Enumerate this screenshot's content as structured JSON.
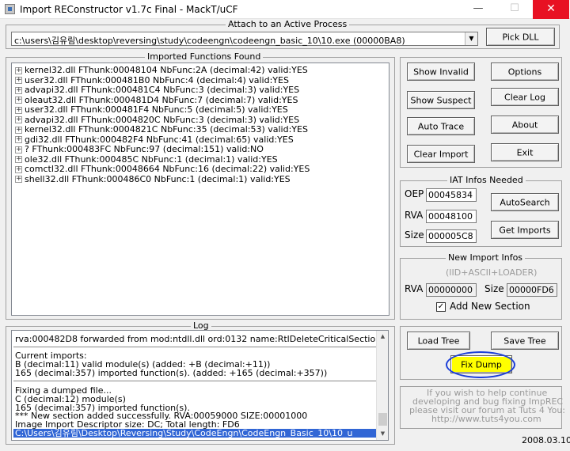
{
  "window": {
    "title": "Import REConstructor v1.7c Final - MackT/uCF",
    "controls": {
      "minimize": "—",
      "maximize": "☐",
      "close": "✕"
    }
  },
  "attach": {
    "group_title": "Attach to an Active Process",
    "process": "c:\\users\\김유림\\desktop\\reversing\\study\\codeengn\\codeengn_basic_10\\10.exe (00000BA8)",
    "pick_dll": "Pick DLL"
  },
  "imports": {
    "group_title": "Imported Functions Found",
    "rows": [
      "kernel32.dll FThunk:00048104 NbFunc:2A (decimal:42) valid:YES",
      "user32.dll FThunk:000481B0 NbFunc:4 (decimal:4) valid:YES",
      "advapi32.dll FThunk:000481C4 NbFunc:3 (decimal:3) valid:YES",
      "oleaut32.dll FThunk:000481D4 NbFunc:7 (decimal:7) valid:YES",
      "user32.dll FThunk:000481F4 NbFunc:5 (decimal:5) valid:YES",
      "advapi32.dll FThunk:0004820C NbFunc:3 (decimal:3) valid:YES",
      "kernel32.dll FThunk:0004821C NbFunc:35 (decimal:53) valid:YES",
      "gdi32.dll FThunk:000482F4 NbFunc:41 (decimal:65) valid:YES",
      "? FThunk:000483FC NbFunc:97 (decimal:151) valid:NO",
      "ole32.dll FThunk:000485C NbFunc:1 (decimal:1) valid:YES",
      "comctl32.dll FThunk:00048664 NbFunc:16 (decimal:22) valid:YES",
      "shell32.dll FThunk:000486C0 NbFunc:1 (decimal:1) valid:YES"
    ]
  },
  "buttons": {
    "show_invalid": "Show Invalid",
    "show_suspect": "Show Suspect",
    "auto_trace": "Auto Trace",
    "clear_imports": "Clear Import",
    "options": "Options",
    "clear_log": "Clear Log",
    "about": "About",
    "exit": "Exit",
    "autosearch": "AutoSearch",
    "get_imports": "Get Imports",
    "load_tree": "Load Tree",
    "save_tree": "Save Tree",
    "fix_dump": "Fix Dump"
  },
  "iat": {
    "group_title": "IAT Infos Needed",
    "oep_label": "OEP",
    "oep": "00045834",
    "rva_label": "RVA",
    "rva": "00048100",
    "size_label": "Size",
    "size": "000005C8"
  },
  "new_import": {
    "group_title": "New Import Infos",
    "subtitle": "(IID+ASCII+LOADER)",
    "rva_label": "RVA",
    "rva": "00000000",
    "size_label": "Size",
    "size": "00000FD6",
    "add_section_label": "Add New Section",
    "add_section_checked": "✓"
  },
  "log": {
    "group_title": "Log",
    "lines": [
      "rva:000482D8 forwarded from mod:ntdll.dll ord:0132 name:RtlDeleteCriticalSection",
      "Current imports:",
      "B (decimal:11) valid module(s) (added: +B (decimal:+11))",
      "165 (decimal:357) imported function(s). (added: +165 (decimal:+357))",
      "Fixing a dumped file...",
      "C (decimal:12) module(s)",
      "165 (decimal:357) imported function(s).",
      "*** New section added successfully. RVA:00059000 SIZE:00001000",
      "Image Import Descriptor size: DC; Total length: FD6",
      "C:\\Users\\김유림\\Desktop\\Reversing\\Study\\CodeEngn\\CodeEngn_Basic_10\\10_u"
    ]
  },
  "help": {
    "text1": "If you wish to help continue",
    "text2": "developing and bug fixing ImpREC",
    "text3": "please visit our forum at Tuts 4 You:",
    "url": "http://www.tuts4you.com"
  },
  "date": "2008.03.10",
  "scroll_arrows": {
    "up": "▲",
    "down": "▼"
  },
  "icons": {
    "expand": "+",
    "combo": "▼"
  }
}
